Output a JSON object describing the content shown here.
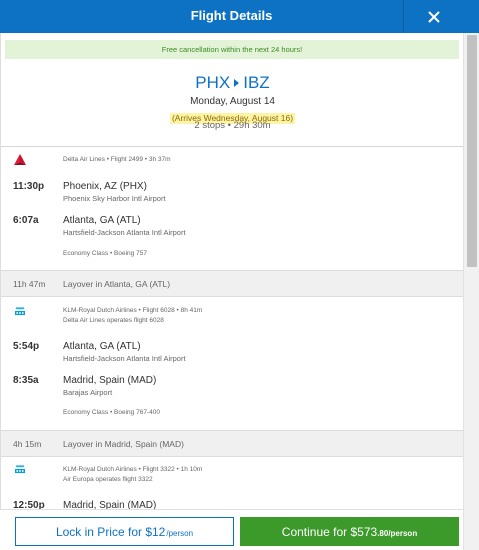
{
  "header": {
    "title": "Flight Details",
    "close_icon": "close-icon"
  },
  "banner": "Free cancellation within the next 24 hours!",
  "summary": {
    "origin": "PHX",
    "destination": "IBZ",
    "date": "Monday, August 14",
    "arrives": "(Arrives Wednesday, August 16)",
    "stops": "2 stops • 29h 30m"
  },
  "segments": [
    {
      "airline_icon": "delta-logo-icon",
      "info": "Delta Air Lines • Flight 2499 • 3h 37m",
      "operated_by": "",
      "depart_time": "11:30p",
      "depart_place": "Phoenix, AZ (PHX)",
      "depart_airport": "Phoenix Sky Harbor Intl Airport",
      "arrive_time": "6:07a",
      "arrive_place": "Atlanta, GA (ATL)",
      "arrive_airport": "Hartsfield-Jackson Atlanta Intl Airport",
      "cabin": "Economy Class • Boeing 757"
    },
    {
      "airline_icon": "klm-logo-icon",
      "info": "KLM-Royal Dutch Airlines • Flight 6028 • 8h 41m",
      "operated_by": "Delta Air Lines operates flight 6028",
      "depart_time": "5:54p",
      "depart_place": "Atlanta, GA (ATL)",
      "depart_airport": "Hartsfield-Jackson Atlanta Intl Airport",
      "arrive_time": "8:35a",
      "arrive_place": "Madrid, Spain (MAD)",
      "arrive_airport": "Barajas Airport",
      "cabin": "Economy Class • Boeing 767-400"
    },
    {
      "airline_icon": "klm-logo-icon",
      "info": "KLM-Royal Dutch Airlines • Flight 3322 • 1h 10m",
      "operated_by": "Air Europa operates flight 3322",
      "depart_time": "12:50p",
      "depart_place": "Madrid, Spain (MAD)"
    }
  ],
  "layovers": [
    {
      "duration": "11h 47m",
      "label": "Layover in Atlanta, GA (ATL)"
    },
    {
      "duration": "4h 15m",
      "label": "Layover in Madrid, Spain (MAD)"
    }
  ],
  "footer": {
    "lock_label": "Lock in Price for $12",
    "lock_per": "/person",
    "continue_label": "Continue for $573",
    "continue_cents": ".80",
    "continue_per": "/person"
  },
  "colors": {
    "brand_blue": "#0e72c4",
    "accent_green": "#3c9a2a",
    "banner_bg": "#e3f3d8",
    "highlight": "#fff3a6"
  }
}
